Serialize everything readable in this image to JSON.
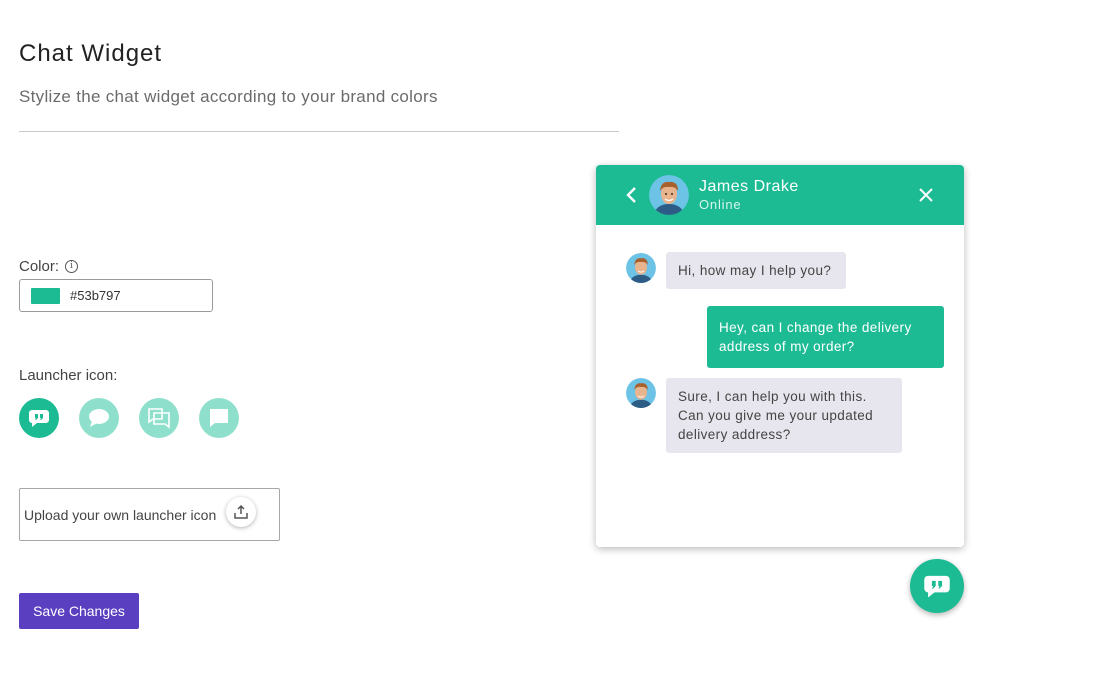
{
  "page": {
    "title": "Chat Widget",
    "subtitle": "Stylize the chat widget according to your brand colors"
  },
  "color": {
    "label": "Color:",
    "info_icon": "info-icon",
    "value": "#53b797",
    "swatch_hex": "#1dbb94"
  },
  "launcher": {
    "label": "Launcher icon:",
    "options": [
      {
        "icon": "quote-bubble-icon",
        "selected": true
      },
      {
        "icon": "speech-bubble-icon",
        "selected": false
      },
      {
        "icon": "double-square-bubble-icon",
        "selected": false
      },
      {
        "icon": "square-bubble-icon",
        "selected": false
      }
    ]
  },
  "upload": {
    "label": "Upload your own launcher icon",
    "icon": "upload-icon"
  },
  "save_button": {
    "label": "Save Changes",
    "color": "#5a3fc0"
  },
  "colors": {
    "accent": "#1dbb94",
    "accent_light": "#8edfcb",
    "bubble_in": "#e7e6ee"
  },
  "chat": {
    "agent_name": "James Drake",
    "status": "Online",
    "messages": [
      {
        "from": "agent",
        "text": "Hi, how may I help you?"
      },
      {
        "from": "user",
        "text": "Hey, can I change the delivery address of my order?"
      },
      {
        "from": "agent",
        "text": "Sure, I can help you with this. Can you give me your updated delivery address?"
      }
    ]
  }
}
